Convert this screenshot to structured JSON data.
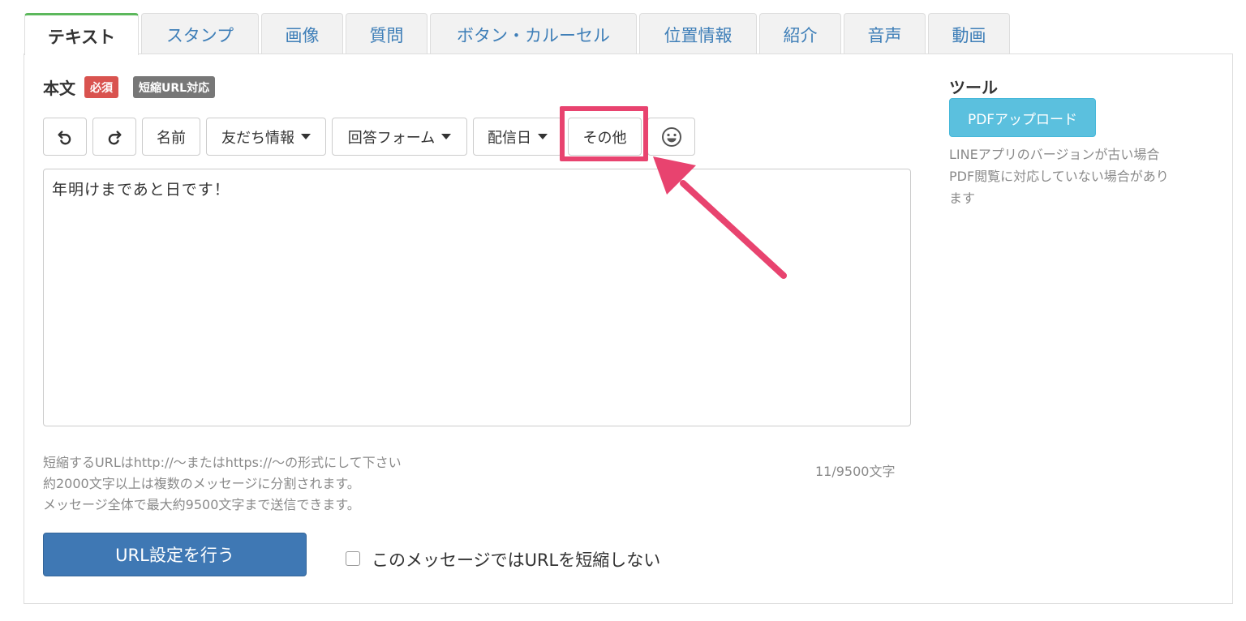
{
  "tabs": [
    {
      "label": "テキスト",
      "active": true
    },
    {
      "label": "スタンプ"
    },
    {
      "label": "画像"
    },
    {
      "label": "質問"
    },
    {
      "label": "ボタン・カルーセル"
    },
    {
      "label": "位置情報"
    },
    {
      "label": "紹介"
    },
    {
      "label": "音声"
    },
    {
      "label": "動画"
    }
  ],
  "body": {
    "label": "本文",
    "badge_required": "必須",
    "badge_short_url": "短縮URL対応",
    "badge_required_color": "#d9534f",
    "badge_short_url_color": "#777777"
  },
  "toolbar": {
    "undo_icon": "undo-icon",
    "redo_icon": "redo-icon",
    "name": "名前",
    "friend_info": "友だち情報",
    "answer_form": "回答フォーム",
    "delivery_date": "配信日",
    "other": "その他",
    "emoji_icon": "smiley-icon"
  },
  "editor": {
    "value": "年明けまであと日です！"
  },
  "help": {
    "line1": "短縮するURLはhttp://〜またはhttps://〜の形式にして下さい",
    "line2": "約2000文字以上は複数のメッセージに分割されます。",
    "line3": "メッセージ全体で最大約9500文字まで送信できます。",
    "counter": "11/9500文字"
  },
  "actions": {
    "url_settings": "URL設定を行う",
    "no_shorten_label": "このメッセージではURLを短縮しない",
    "no_shorten_checked": false
  },
  "tools": {
    "title": "ツール",
    "pdf_upload": "PDFアップロード",
    "note_line1": "LINEアプリのバージョンが古い場合",
    "note_line2": "PDF閲覧に対応していない場合があり",
    "note_line3": "ます"
  },
  "annotation": {
    "color": "#e8436f"
  }
}
